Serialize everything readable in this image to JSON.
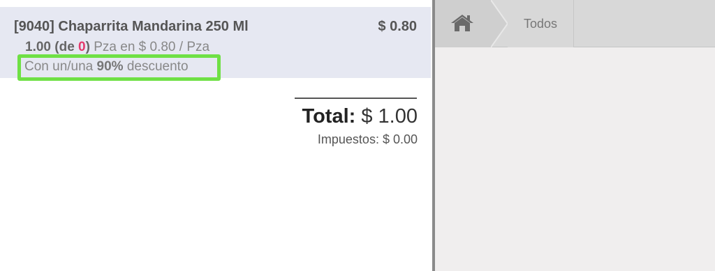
{
  "order": {
    "line": {
      "product_name": "[9040] Chaparrita Mandarina 250 Ml",
      "price": "$ 0.80",
      "qty": "1.00",
      "qty_de": "(de ",
      "qty_stock": "0",
      "qty_close": ")",
      "unit_info": " Pza en $ 0.80 / Pza",
      "discount_prefix": "Con un/una ",
      "discount_pct": "90%",
      "discount_suffix": " descuento"
    },
    "summary": {
      "total_label": "Total:",
      "total_value": " $ 1.00",
      "taxes": "Impuestos: $ 0.00"
    }
  },
  "breadcrumbs": {
    "home_icon": "home-icon",
    "items": [
      "Todos"
    ]
  },
  "colors": {
    "orderline_bg": "#e6e8f2",
    "highlight_border": "#6fe045",
    "stock_red": "#e43a6c"
  }
}
